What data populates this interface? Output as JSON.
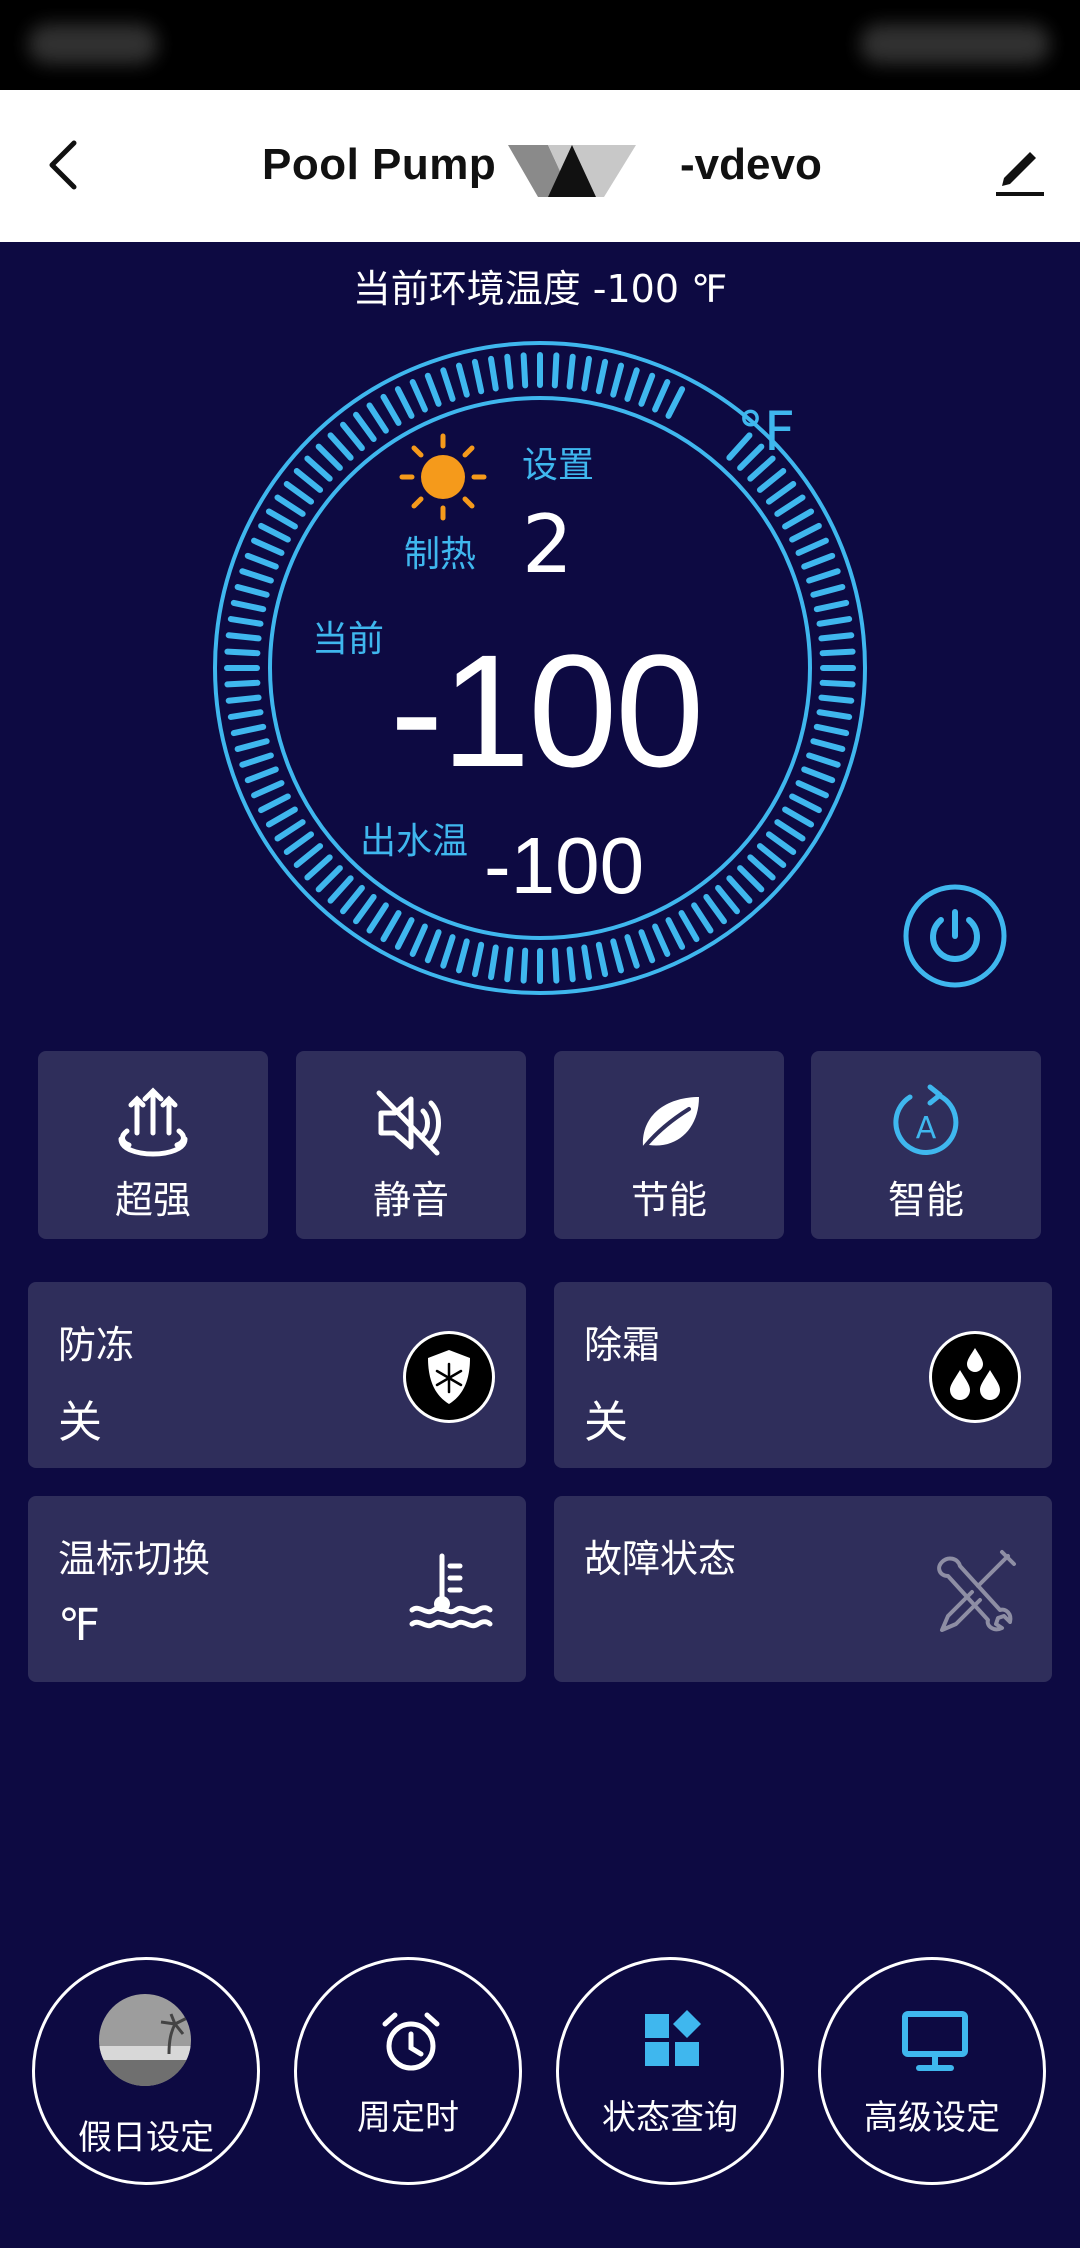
{
  "header": {
    "title_left": "Pool Pump",
    "title_right": "-vdevo"
  },
  "ambient_text": "当前环境温度 -100 ℉",
  "dial": {
    "unit": "°F",
    "set_label": "设置",
    "set_value": "2",
    "mode_label": "制热",
    "current_label": "当前",
    "current_value": "-100",
    "outlet_label": "出水温",
    "outlet_value": "-100"
  },
  "modes": [
    {
      "label": "超强",
      "icon": "turbo-heat-icon"
    },
    {
      "label": "静音",
      "icon": "mute-icon"
    },
    {
      "label": "节能",
      "icon": "leaf-icon"
    },
    {
      "label": "智能",
      "icon": "auto-mode-icon"
    }
  ],
  "cards": {
    "antifreeze": {
      "title": "防冻",
      "value": "关",
      "icon": "snowflake-shield-icon"
    },
    "defrost": {
      "title": "除霜",
      "value": "关",
      "icon": "water-drops-icon"
    },
    "unit_switch": {
      "title": "温标切换",
      "value": "℉",
      "icon": "water-thermometer-icon"
    },
    "fault": {
      "title": "故障状态",
      "icon": "wrench-screwdriver-icon"
    }
  },
  "bottom": [
    {
      "label": "假日设定",
      "icon": "holiday-beach-icon"
    },
    {
      "label": "周定时",
      "icon": "alarm-clock-icon"
    },
    {
      "label": "状态查询",
      "icon": "status-grid-icon"
    },
    {
      "label": "高级设定",
      "icon": "monitor-icon"
    }
  ],
  "colors": {
    "background": "#0d0a42",
    "card": "#2f2e5b",
    "accent": "#3fb7ee",
    "sun": "#f59a1b"
  }
}
